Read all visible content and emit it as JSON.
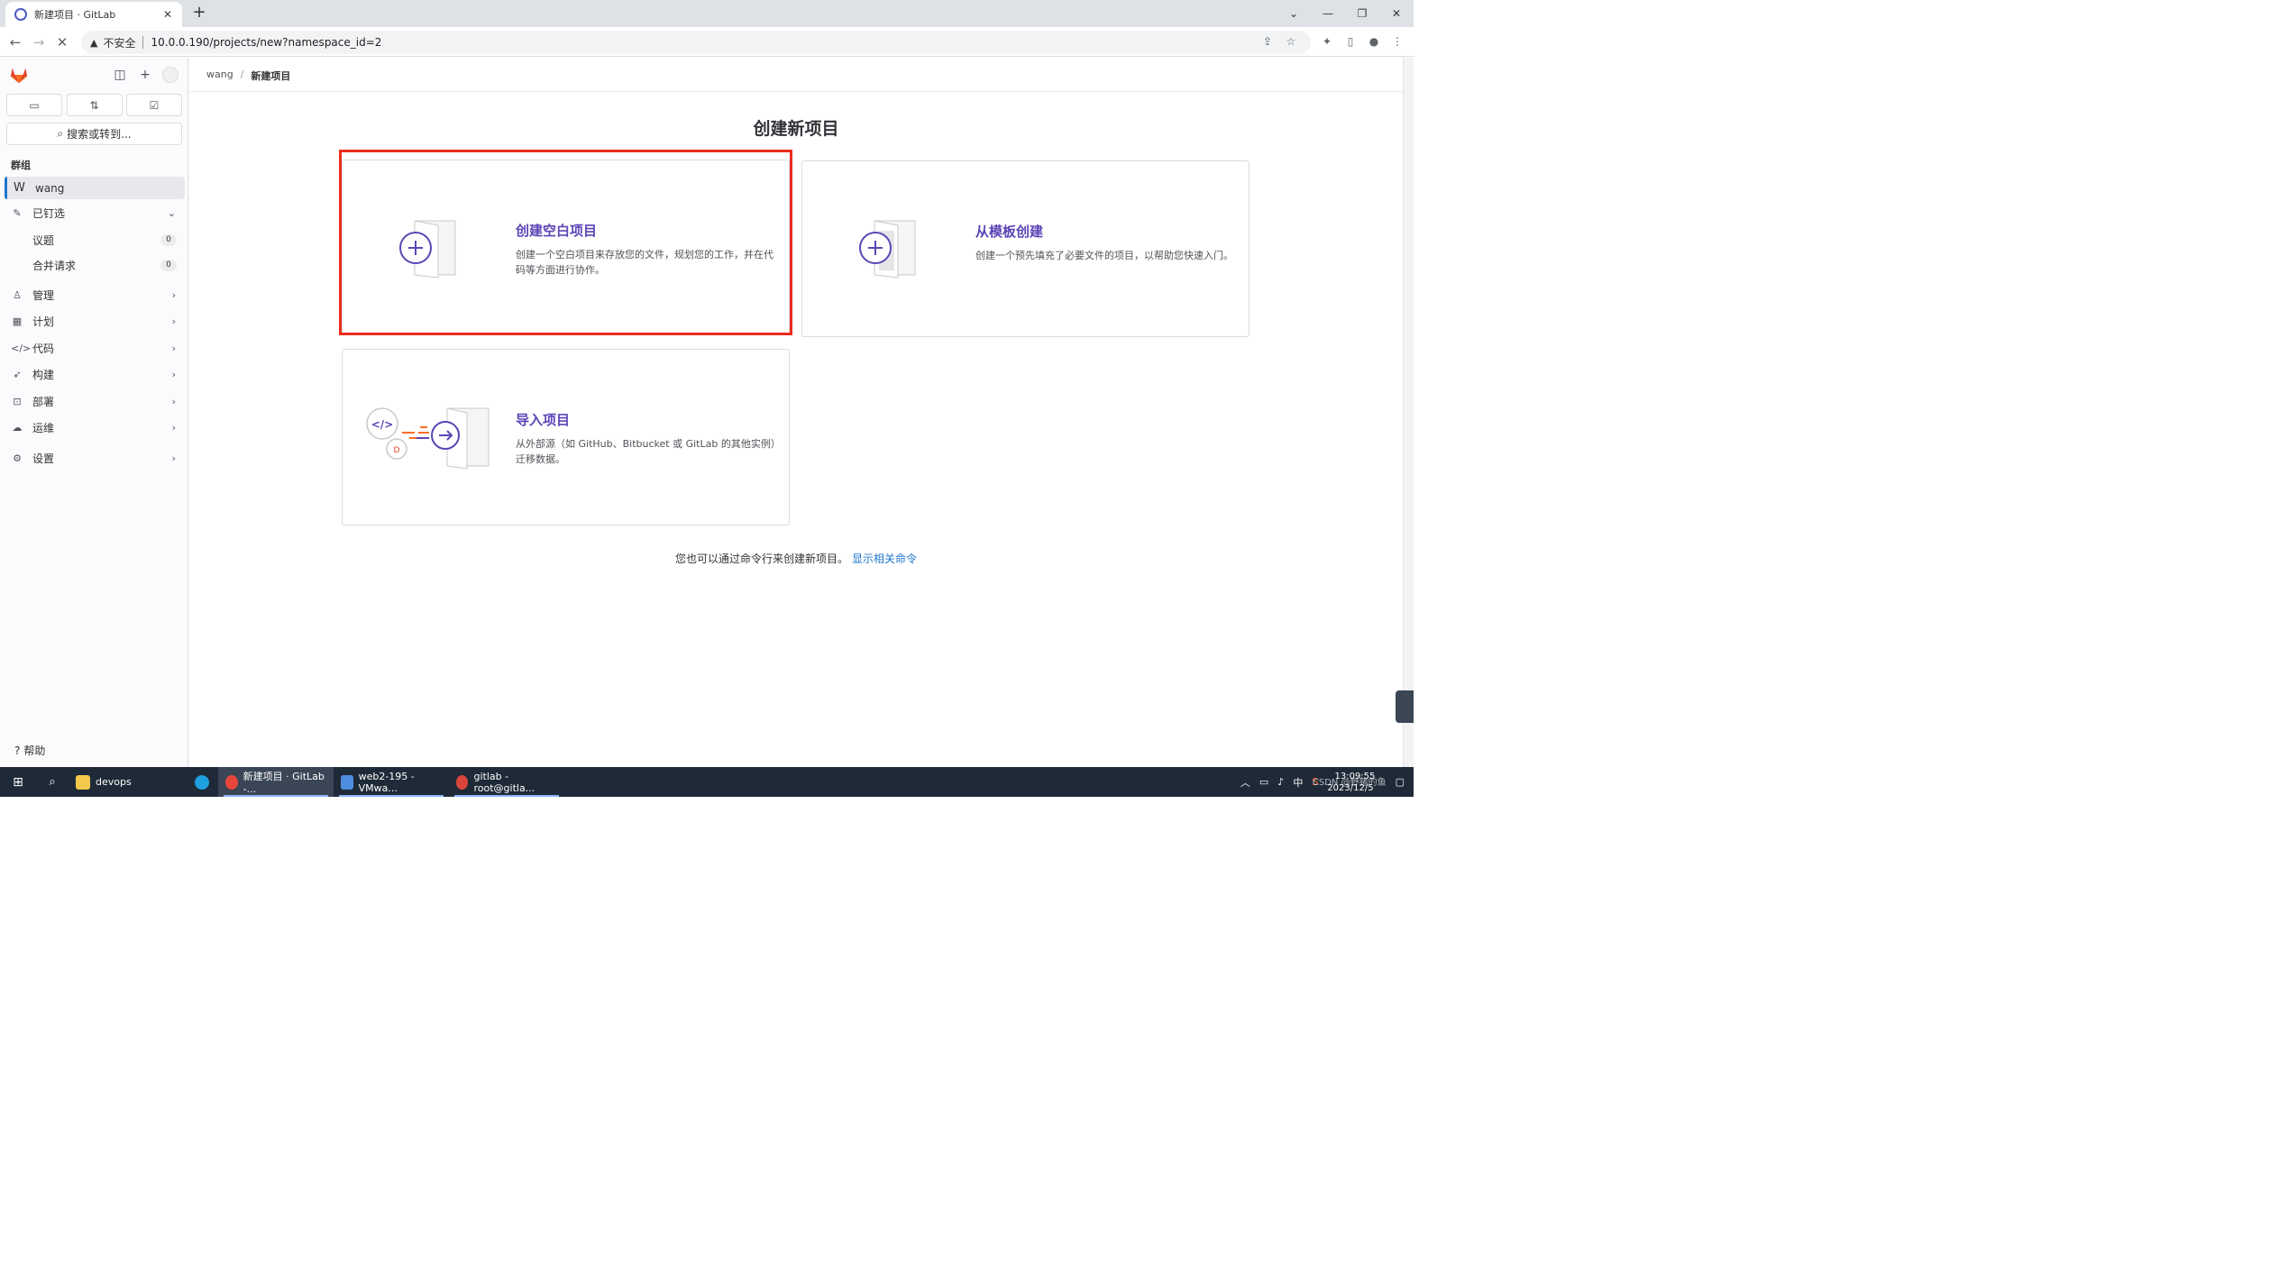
{
  "browser": {
    "tab_title": "新建项目 · GitLab",
    "insecure_label": "不安全",
    "url": "10.0.0.190/projects/new?namespace_id=2"
  },
  "sidebar": {
    "search_label": "搜索或转到...",
    "section_label": "群组",
    "group": {
      "letter": "W",
      "name": "wang"
    },
    "pinned": {
      "label": "已钉选",
      "items": [
        {
          "label": "议题",
          "count": "0"
        },
        {
          "label": "合并请求",
          "count": "0"
        }
      ]
    },
    "nav": [
      {
        "label": "管理",
        "icon": "users-icon"
      },
      {
        "label": "计划",
        "icon": "calendar-icon"
      },
      {
        "label": "代码",
        "icon": "code-icon"
      },
      {
        "label": "构建",
        "icon": "rocket-icon"
      },
      {
        "label": "部署",
        "icon": "deployments-icon"
      },
      {
        "label": "运维",
        "icon": "cloud-gear-icon"
      },
      {
        "label": "设置",
        "icon": "settings-icon"
      }
    ],
    "help_label": "帮助"
  },
  "breadcrumb": {
    "parent": "wang",
    "current": "新建项目"
  },
  "page": {
    "title": "创建新项目",
    "cards": {
      "blank": {
        "title": "创建空白项目",
        "desc": "创建一个空白项目来存放您的文件，规划您的工作，并在代码等方面进行协作。"
      },
      "template": {
        "title": "从模板创建",
        "desc": "创建一个预先填充了必要文件的项目，以帮助您快速入门。"
      },
      "import": {
        "title": "导入项目",
        "desc": "从外部源（如 GitHub、Bitbucket 或 GitLab 的其他实例）迁移数据。"
      }
    },
    "footer_text": "您也可以通过命令行来创建新项目。",
    "footer_link": "显示相关命令"
  },
  "taskbar": {
    "items": [
      {
        "label": "devops"
      },
      {
        "label": "新建项目 · GitLab -..."
      },
      {
        "label": "web2-195 - VMwa..."
      },
      {
        "label": "gitlab - root@gitla..."
      }
    ],
    "ime": "中",
    "time": "13:09:55",
    "date": "2023/12/5",
    "watermark": "CSDN @野猪的鱼"
  },
  "colors": {
    "accent_purple": "#5c45b5",
    "highlight_red": "#ec2c1e",
    "link_blue": "#1f75cb",
    "gitlab_orange": "#e24329"
  }
}
